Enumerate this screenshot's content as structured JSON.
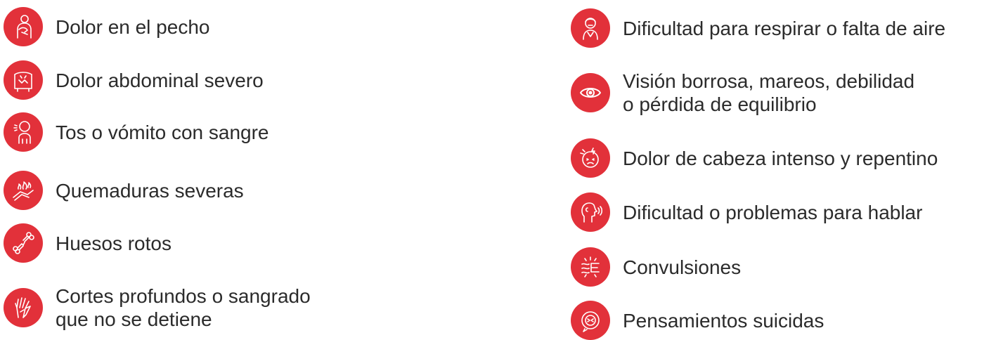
{
  "accent_color": "#e2313a",
  "left_items": [
    {
      "label": "Dolor en el pecho",
      "icon": "chest-pain-icon"
    },
    {
      "label": "Dolor abdominal severo",
      "icon": "abdominal-pain-icon"
    },
    {
      "label": "Tos o vómito con sangre",
      "icon": "cough-blood-icon"
    },
    {
      "label": "Quemaduras severas",
      "icon": "burn-icon"
    },
    {
      "label": "Huesos rotos",
      "icon": "broken-bone-icon"
    },
    {
      "label": "Cortes profundos o sangrado\nque no se detiene",
      "icon": "bleeding-hand-icon"
    }
  ],
  "right_items": [
    {
      "label": "Dificultad para respirar o falta de aire",
      "icon": "breathing-difficulty-icon"
    },
    {
      "label": "Visión borrosa, mareos, debilidad\no pérdida de equilibrio",
      "icon": "eye-icon"
    },
    {
      "label": "Dolor de cabeza intenso y repentino",
      "icon": "headache-icon"
    },
    {
      "label": "Dificultad o problemas para hablar",
      "icon": "speech-difficulty-icon"
    },
    {
      "label": "Convulsiones",
      "icon": "seizure-icon"
    },
    {
      "label": "Pensamientos suicidas",
      "icon": "suicidal-thoughts-icon"
    }
  ]
}
